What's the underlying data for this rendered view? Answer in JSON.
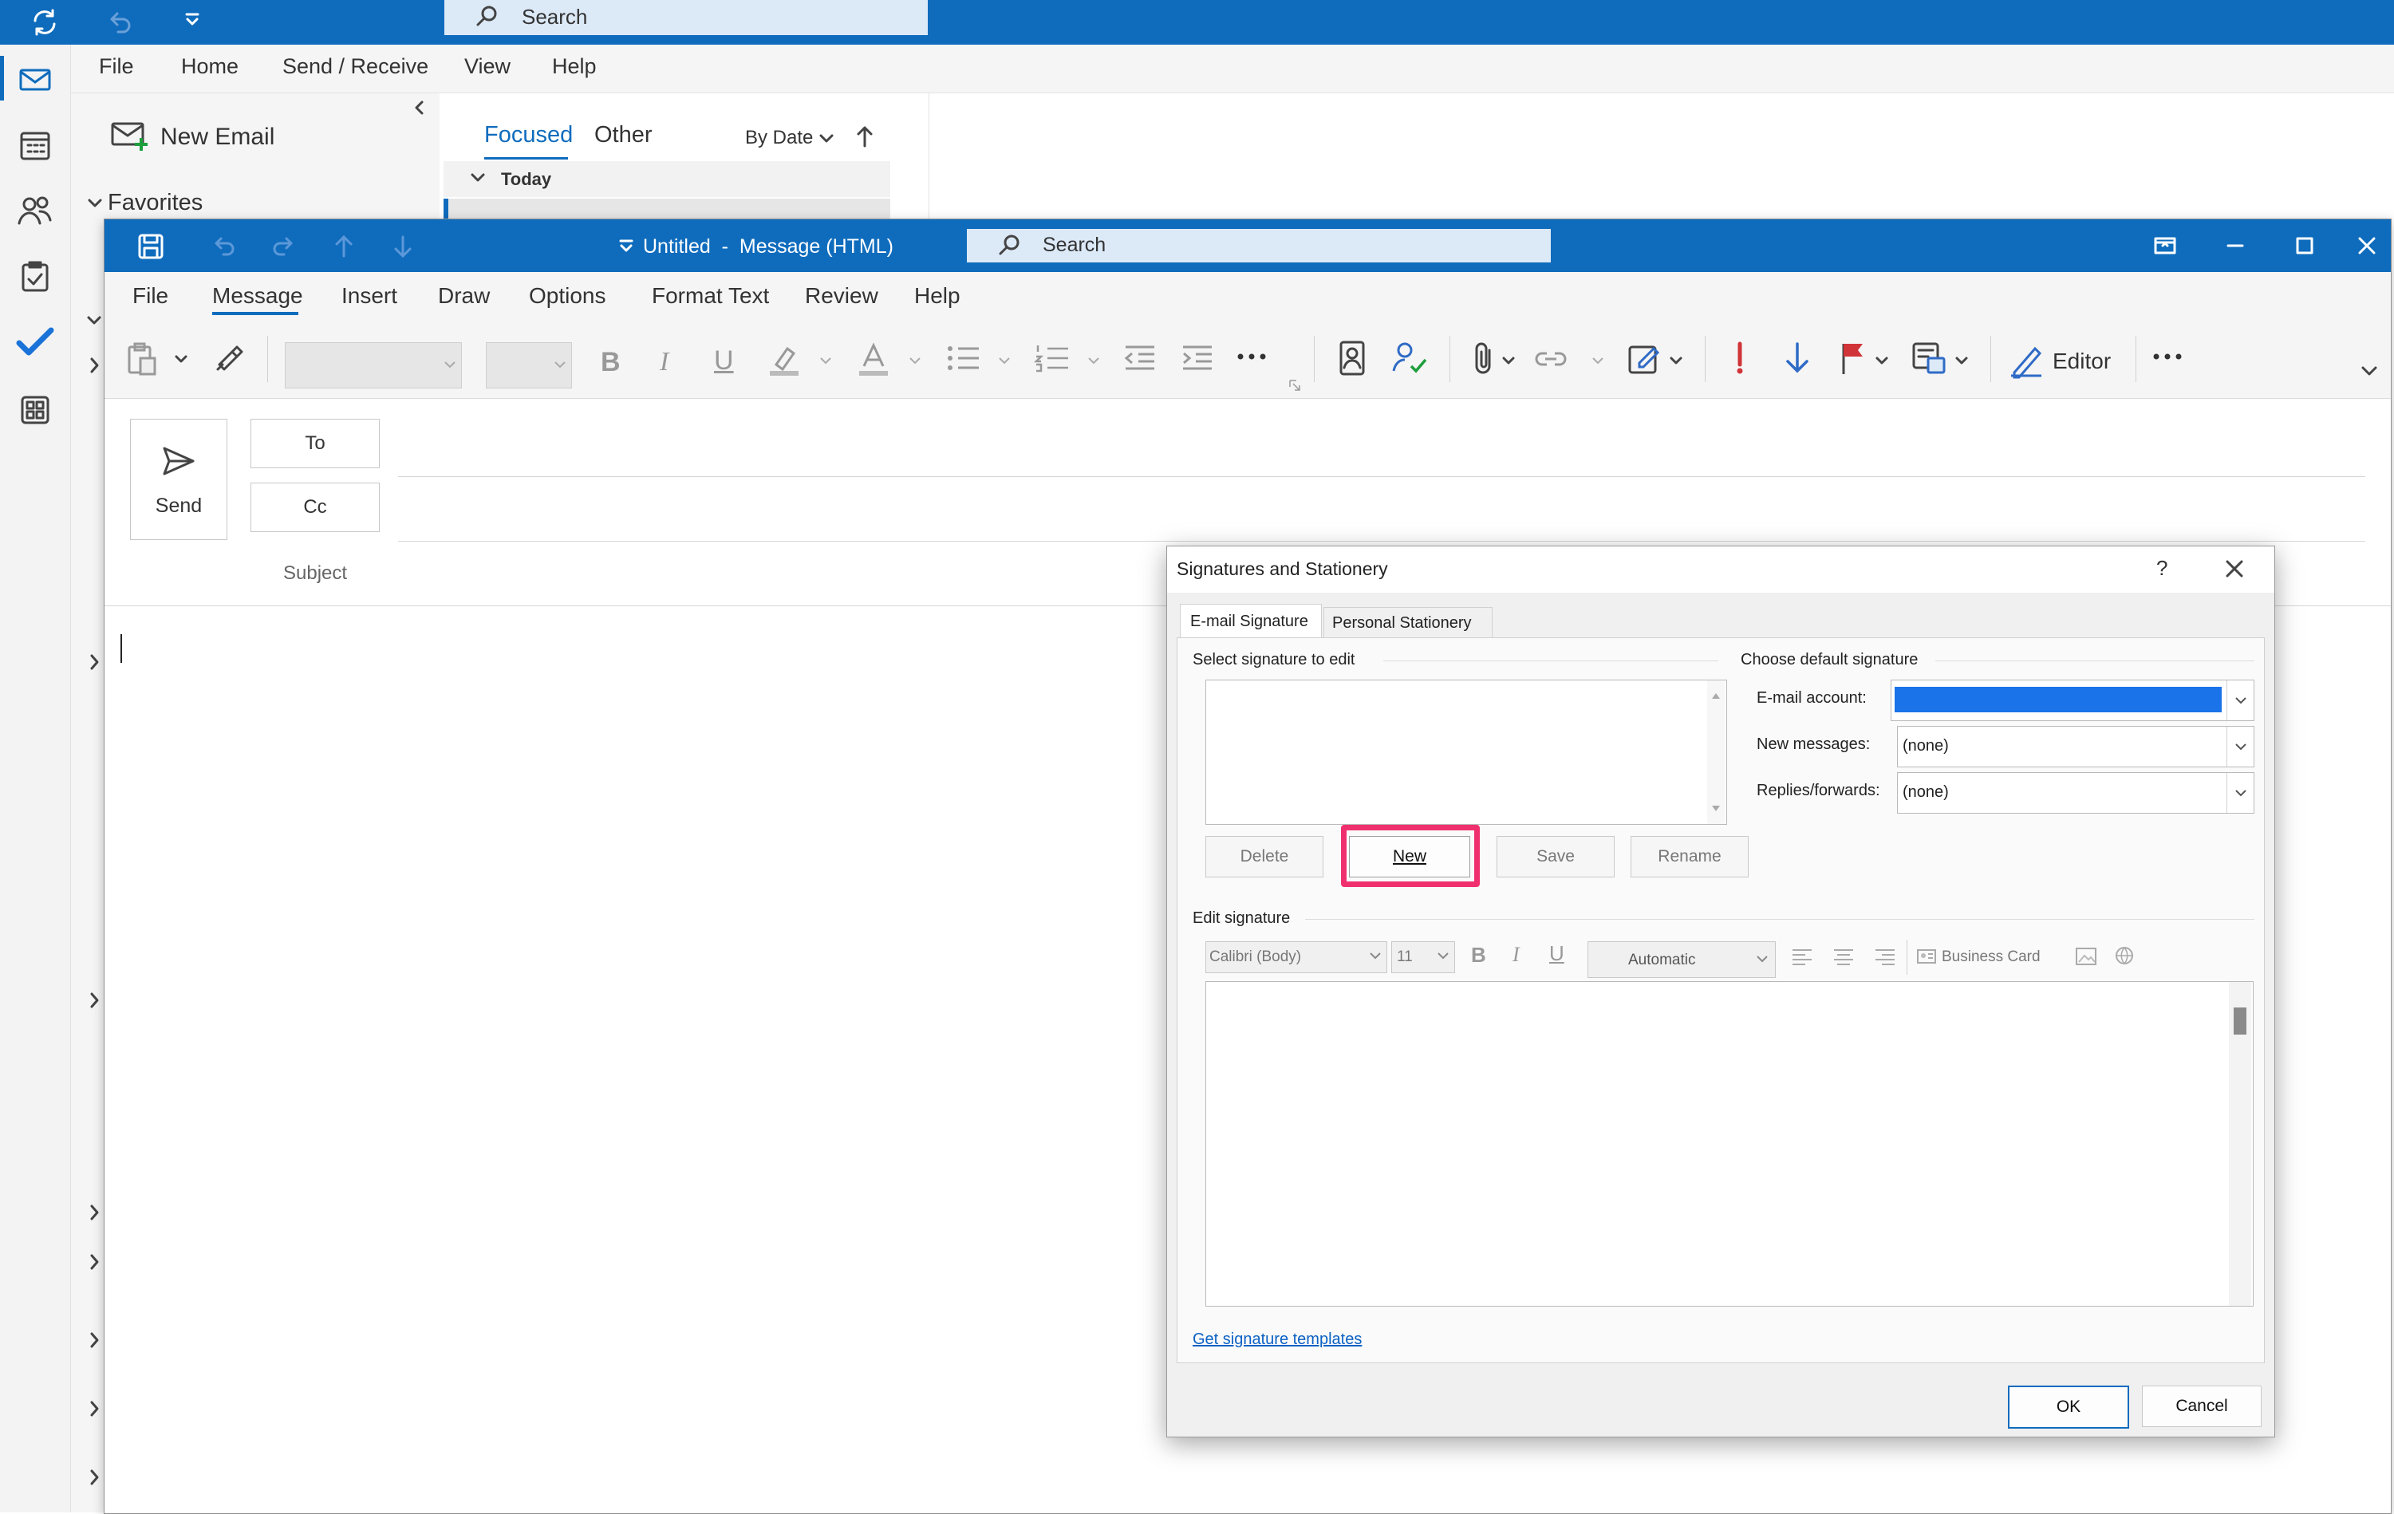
{
  "outlook": {
    "search_placeholder": "Search",
    "menu": [
      "File",
      "Home",
      "Send / Receive",
      "View",
      "Help"
    ],
    "new_email_label": "New Email",
    "favorites_label": "Favorites",
    "tabs": [
      "Focused",
      "Other"
    ],
    "sort_label": "By Date",
    "group_today": "Today"
  },
  "compose": {
    "title": "Untitled  -  Message (HTML)",
    "search_placeholder": "Search",
    "menu": [
      "File",
      "Message",
      "Insert",
      "Draw",
      "Options",
      "Format Text",
      "Review",
      "Help"
    ],
    "active_tab": "Message",
    "editor_label": "Editor",
    "send_label": "Send",
    "to_label": "To",
    "cc_label": "Cc",
    "subject_label": "Subject"
  },
  "dialog": {
    "title": "Signatures and Stationery",
    "help": "?",
    "tabs": [
      "E-mail Signature",
      "Personal Stationery"
    ],
    "select_label": "Select signature to edit",
    "default_label": "Choose default signature",
    "email_account_label": "E-mail account:",
    "new_messages_label": "New messages:",
    "new_messages_value": "(none)",
    "replies_label": "Replies/forwards:",
    "replies_value": "(none)",
    "buttons": {
      "delete": "Delete",
      "new": "New",
      "save": "Save",
      "rename": "Rename",
      "ok": "OK",
      "cancel": "Cancel"
    },
    "edit_label": "Edit signature",
    "font_value": "Calibri (Body)",
    "size_value": "11",
    "color_value": "Automatic",
    "business_card_label": "Business Card",
    "templates_link": "Get signature templates",
    "highlight_color": "#f0306e"
  },
  "colors": {
    "accent": "#0f6cbd"
  }
}
